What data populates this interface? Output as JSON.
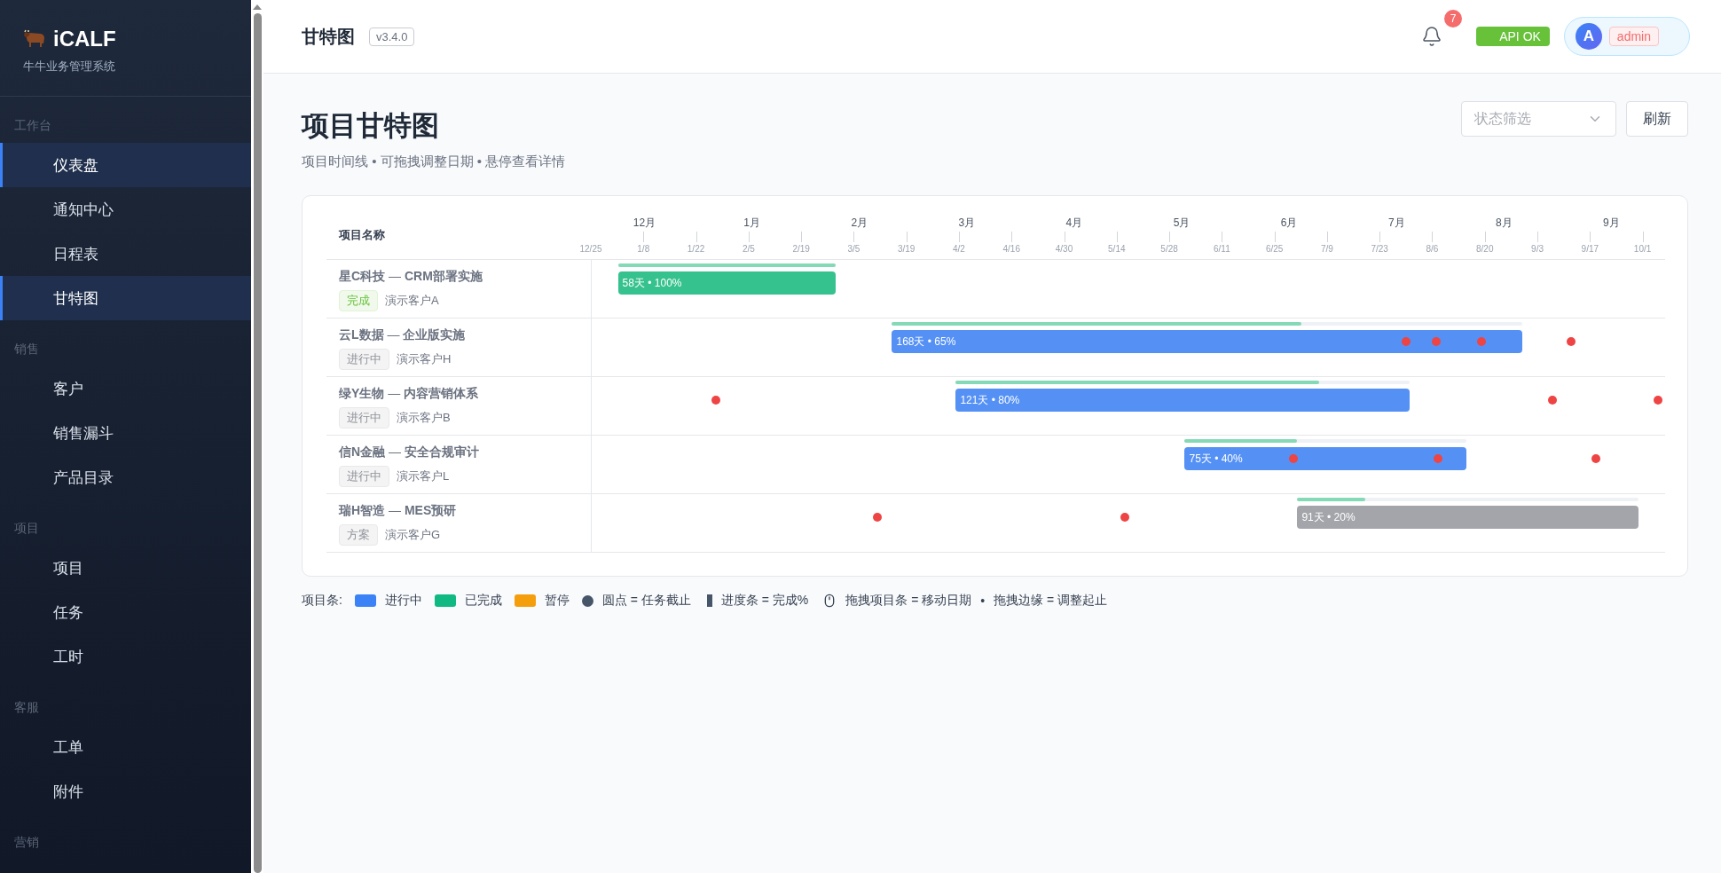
{
  "sidebar": {
    "brand": "iCALF",
    "subtitle": "牛牛业务管理系统",
    "groups": [
      {
        "label": "工作台",
        "items": [
          {
            "label": "仪表盘",
            "selected": true
          },
          {
            "label": "通知中心",
            "selected": false
          },
          {
            "label": "日程表",
            "selected": false
          },
          {
            "label": "甘特图",
            "selected": true
          }
        ]
      },
      {
        "label": "销售",
        "items": [
          {
            "label": "客户",
            "selected": false
          },
          {
            "label": "销售漏斗",
            "selected": false
          },
          {
            "label": "产品目录",
            "selected": false
          }
        ]
      },
      {
        "label": "项目",
        "items": [
          {
            "label": "项目",
            "selected": false
          },
          {
            "label": "任务",
            "selected": false
          },
          {
            "label": "工时",
            "selected": false
          }
        ]
      },
      {
        "label": "客服",
        "items": [
          {
            "label": "工单",
            "selected": false
          },
          {
            "label": "附件",
            "selected": false
          }
        ]
      },
      {
        "label": "营销"
      }
    ]
  },
  "header": {
    "title": "甘特图",
    "version": "v3.4.0",
    "notifications": "7",
    "api_status": "API OK",
    "user": {
      "avatar": "A",
      "name": "admin"
    }
  },
  "page": {
    "title": "项目甘特图",
    "subtitle": "项目时间线 • 可拖拽调整日期 • 悬停查看详情",
    "filter": {
      "placeholder": "状态筛选"
    },
    "refresh": "刷新"
  },
  "gantt": {
    "name_header": "项目名称",
    "months": [
      "12月",
      "1月",
      "2月",
      "3月",
      "4月",
      "5月",
      "6月",
      "7月",
      "8月",
      "9月"
    ],
    "projects": [
      {
        "name": "**星C科技** — **CRM部署实施**",
        "status": "完成",
        "kind": "done",
        "client": "演示客户A",
        "bar_label": "58天 • 100%",
        "level": 1
      },
      {
        "name": "**云L数据** — **企业版实施**",
        "status": "进行中",
        "kind": "active",
        "client": "演示客户H",
        "bar_label": "168天 • 65%",
        "level": 0.65
      },
      {
        "name": "**绿Y生物** — **内容营销体系**",
        "status": "进行中",
        "kind": "active",
        "client": "演示客户B",
        "bar_label": "121天 • 80%",
        "level": 0.8
      },
      {
        "name": "**信N金融** — **安全合规审计**",
        "status": "进行中",
        "kind": "active",
        "client": "演示客户L",
        "bar_label": "75天 • 40%",
        "level": 0.4
      },
      {
        "name": "**瑞H智造** — **MES预研**",
        "status": "方案",
        "kind": "plan",
        "client": "演示客户G",
        "bar_label": "91天 • 20%",
        "level": 0.2
      }
    ],
    "dates": [
      "12/25",
      "1/8",
      "1/22",
      "2/5",
      "2/19",
      "3/5",
      "3/19",
      "4/2",
      "4/16",
      "4/30",
      "5/14",
      "5/28",
      "6/11",
      "6/25",
      "7/9",
      "7/23",
      "8/6",
      "8/20",
      "9/3",
      "9/17",
      "10/1"
    ]
  },
  "legend": {
    "title": "项目条:",
    "items": [
      {
        "kind": "swatch",
        "color": "#3b82f6",
        "label": "进行中"
      },
      {
        "kind": "swatch",
        "color": "#10b981",
        "label": "已完成"
      },
      {
        "kind": "swatch",
        "color": "#f59e0b",
        "label": "暂停"
      },
      {
        "kind": "dot",
        "label": "圆点 = 任务截止"
      },
      {
        "kind": "bar",
        "label": "进度条 = 完成%"
      },
      {
        "kind": "mouse",
        "label": "拖拽项目条 = 移动日期"
      },
      {
        "kind": "separator",
        "label": "•"
      },
      {
        "kind": "text",
        "label": "拖拽边缘 = 调整起止"
      }
    ]
  }
}
